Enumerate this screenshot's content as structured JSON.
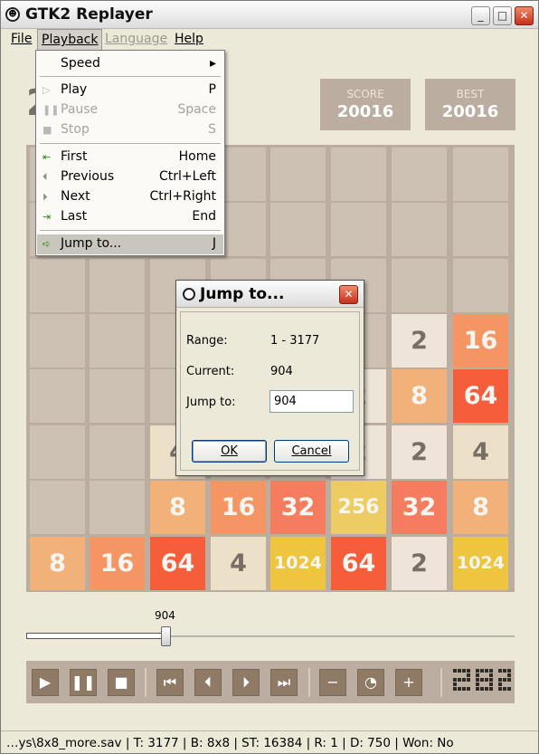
{
  "window": {
    "title": "GTK2 Replayer",
    "minimize": "_",
    "maximize": "□",
    "close": "✕",
    "icon": "smiley-icon"
  },
  "menubar": {
    "file": "File",
    "playback": "Playback",
    "language": "Language",
    "help": "Help"
  },
  "game": {
    "big_number": "2",
    "score_label": "SCORE",
    "score_value": "20016",
    "best_label": "BEST",
    "best_value": "20016",
    "tile_values": [
      [
        "",
        "",
        "",
        "",
        "",
        "",
        "",
        ""
      ],
      [
        "",
        "",
        "",
        "",
        "",
        "",
        "",
        ""
      ],
      [
        "",
        "",
        "",
        "",
        "",
        "",
        "",
        ""
      ],
      [
        "",
        "",
        "",
        "",
        "",
        "",
        "2",
        "16"
      ],
      [
        "",
        "",
        "",
        "",
        "",
        "2",
        "8",
        "64"
      ],
      [
        "",
        "",
        "4",
        "",
        "",
        "2",
        "2",
        "4"
      ],
      [
        "",
        "",
        "8",
        "16",
        "32",
        "256",
        "32",
        "8"
      ],
      [
        "8",
        "16",
        "64",
        "4",
        "1024",
        "64",
        "2",
        "1024"
      ]
    ],
    "colors": {
      "board": "#bbada0",
      "empty": "#cdc1b4",
      "2": "#eee4da",
      "4": "#ede0c8",
      "8": "#f2b179",
      "16": "#f59563",
      "32": "#f67c5f",
      "64": "#f65e3b",
      "256": "#edcc61",
      "1024": "#edc53f",
      "dark_text": "#776e65",
      "light_text": "#f9f6f2"
    }
  },
  "slider": {
    "value_label": "904",
    "position_fraction": 0.2846
  },
  "toolbar": {
    "buttons": [
      {
        "name": "play-button",
        "icon": "play-icon",
        "glyph": "▶"
      },
      {
        "name": "pause-button",
        "icon": "pause-icon",
        "glyph": "❚❚"
      },
      {
        "name": "stop-button",
        "icon": "stop-icon",
        "glyph": "■"
      },
      {
        "name": "first-button",
        "icon": "skip-first-icon",
        "glyph": "⏮"
      },
      {
        "name": "previous-button",
        "icon": "step-back-icon",
        "glyph": "⏴"
      },
      {
        "name": "next-button",
        "icon": "step-forward-icon",
        "glyph": "⏵"
      },
      {
        "name": "last-button",
        "icon": "skip-last-icon",
        "glyph": "⏭"
      },
      {
        "name": "zoom-out-button",
        "icon": "minus-icon",
        "glyph": "−"
      },
      {
        "name": "speed-gauge-button",
        "icon": "gauge-icon",
        "glyph": "◔"
      },
      {
        "name": "zoom-in-button",
        "icon": "plus-icon",
        "glyph": "+"
      }
    ]
  },
  "statusbar": {
    "text": "…ys\\8x8_more.sav | T: 3177 | B: 8x8 | ST: 16384 | R: 1 | D: 750 | Won: No"
  },
  "playback_menu": {
    "speed": "Speed",
    "play": {
      "label": "Play",
      "shortcut": "P"
    },
    "pause": {
      "label": "Pause",
      "shortcut": "Space"
    },
    "stop": {
      "label": "Stop",
      "shortcut": "S"
    },
    "first": {
      "label": "First",
      "shortcut": "Home"
    },
    "previous": {
      "label": "Previous",
      "shortcut": "Ctrl+Left"
    },
    "next": {
      "label": "Next",
      "shortcut": "Ctrl+Right"
    },
    "last": {
      "label": "Last",
      "shortcut": "End"
    },
    "jump": {
      "label": "Jump to...",
      "shortcut": "J"
    }
  },
  "jump_dialog": {
    "title": "Jump to...",
    "range_label": "Range:",
    "range_value": "1 - 3177",
    "current_label": "Current:",
    "current_value": "904",
    "jump_label": "Jump to:",
    "jump_value": "904",
    "ok": "OK",
    "cancel": "Cancel"
  }
}
